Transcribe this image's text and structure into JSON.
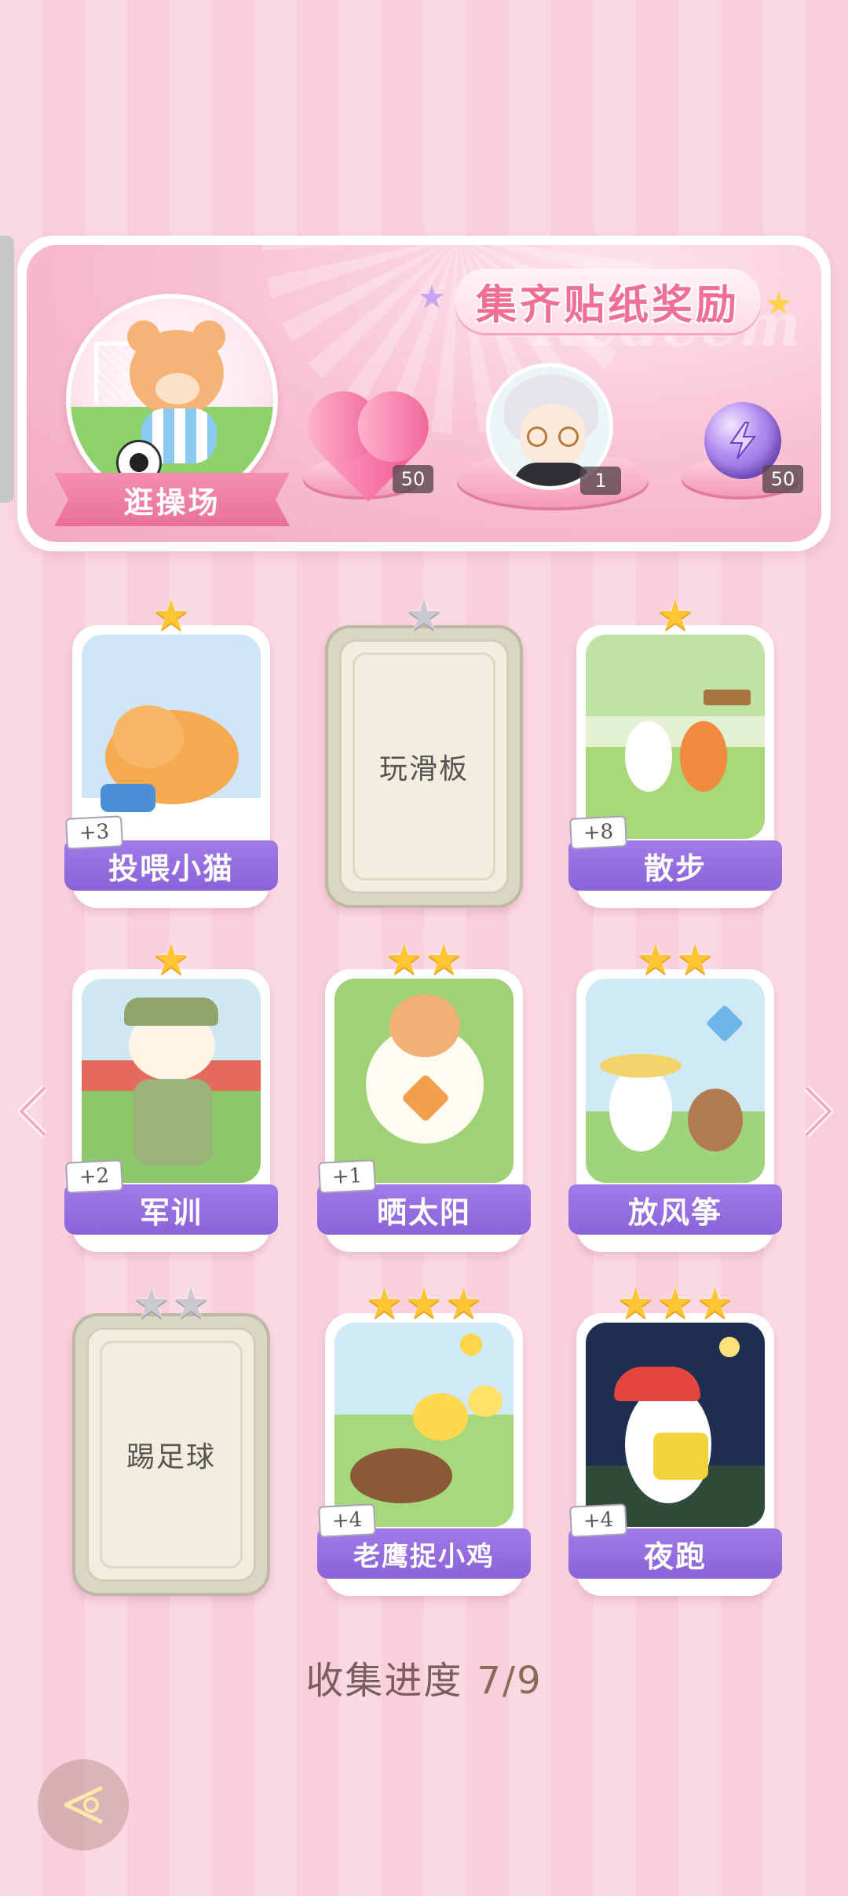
{
  "banner": {
    "title": "集齐贴纸奖励",
    "watermark": "Redeem",
    "location_label": "逛操场",
    "rewards": [
      {
        "name": "pink-heart-gem",
        "count": "50"
      },
      {
        "name": "character-avatar",
        "count": "1"
      },
      {
        "name": "energy-orb",
        "count": "50"
      }
    ]
  },
  "stickers": [
    {
      "label": "投喂小猫",
      "bonus": "+3",
      "stars": 1,
      "collected": true
    },
    {
      "label": "玩滑板",
      "bonus": "",
      "stars": 1,
      "collected": false
    },
    {
      "label": "散步",
      "bonus": "+8",
      "stars": 1,
      "collected": true
    },
    {
      "label": "军训",
      "bonus": "+2",
      "stars": 1,
      "collected": true
    },
    {
      "label": "晒太阳",
      "bonus": "+1",
      "stars": 2,
      "collected": true
    },
    {
      "label": "放风筝",
      "bonus": "",
      "stars": 2,
      "collected": true
    },
    {
      "label": "踢足球",
      "bonus": "",
      "stars": 2,
      "collected": false
    },
    {
      "label": "老鹰捉小鸡",
      "bonus": "+4",
      "stars": 3,
      "collected": true
    },
    {
      "label": "夜跑",
      "bonus": "+4",
      "stars": 3,
      "collected": true
    }
  ],
  "progress": {
    "label": "收集进度",
    "value": "7/9"
  },
  "colors": {
    "accent_purple": "#8a63d8",
    "accent_pink": "#f06f97",
    "star_gold": "#ffc533"
  }
}
